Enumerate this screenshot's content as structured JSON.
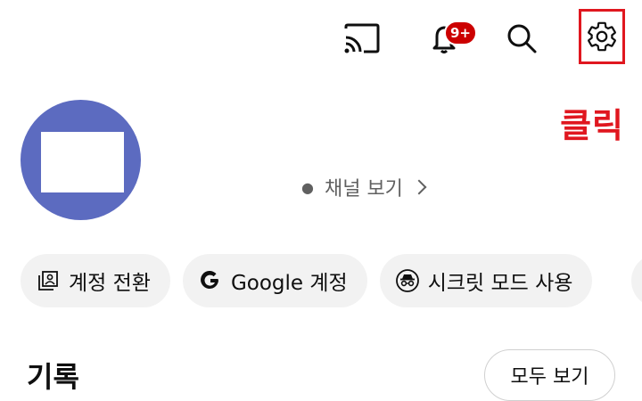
{
  "top_bar": {
    "icons": {
      "cast": "cast-icon",
      "notifications": "bell-icon",
      "search": "search-icon",
      "settings": "gear-icon"
    },
    "notification_badge": "9+"
  },
  "annotation": {
    "click_hint": "클릭",
    "highlight_color": "#e0171f"
  },
  "profile": {
    "avatar_color": "#5c6bc0",
    "channel_link": "채널 보기"
  },
  "chips": [
    {
      "label": "계정 전환",
      "icon": "switch-account-icon"
    },
    {
      "label": "Google 계정",
      "icon": "google-g-icon"
    },
    {
      "label": "시크릿 모드 사용",
      "icon": "incognito-icon"
    }
  ],
  "history": {
    "title": "기록",
    "see_all": "모두 보기"
  },
  "colors": {
    "badge": "#cc0000",
    "chip_bg": "#f2f2f2",
    "secondary_text": "#606060"
  }
}
